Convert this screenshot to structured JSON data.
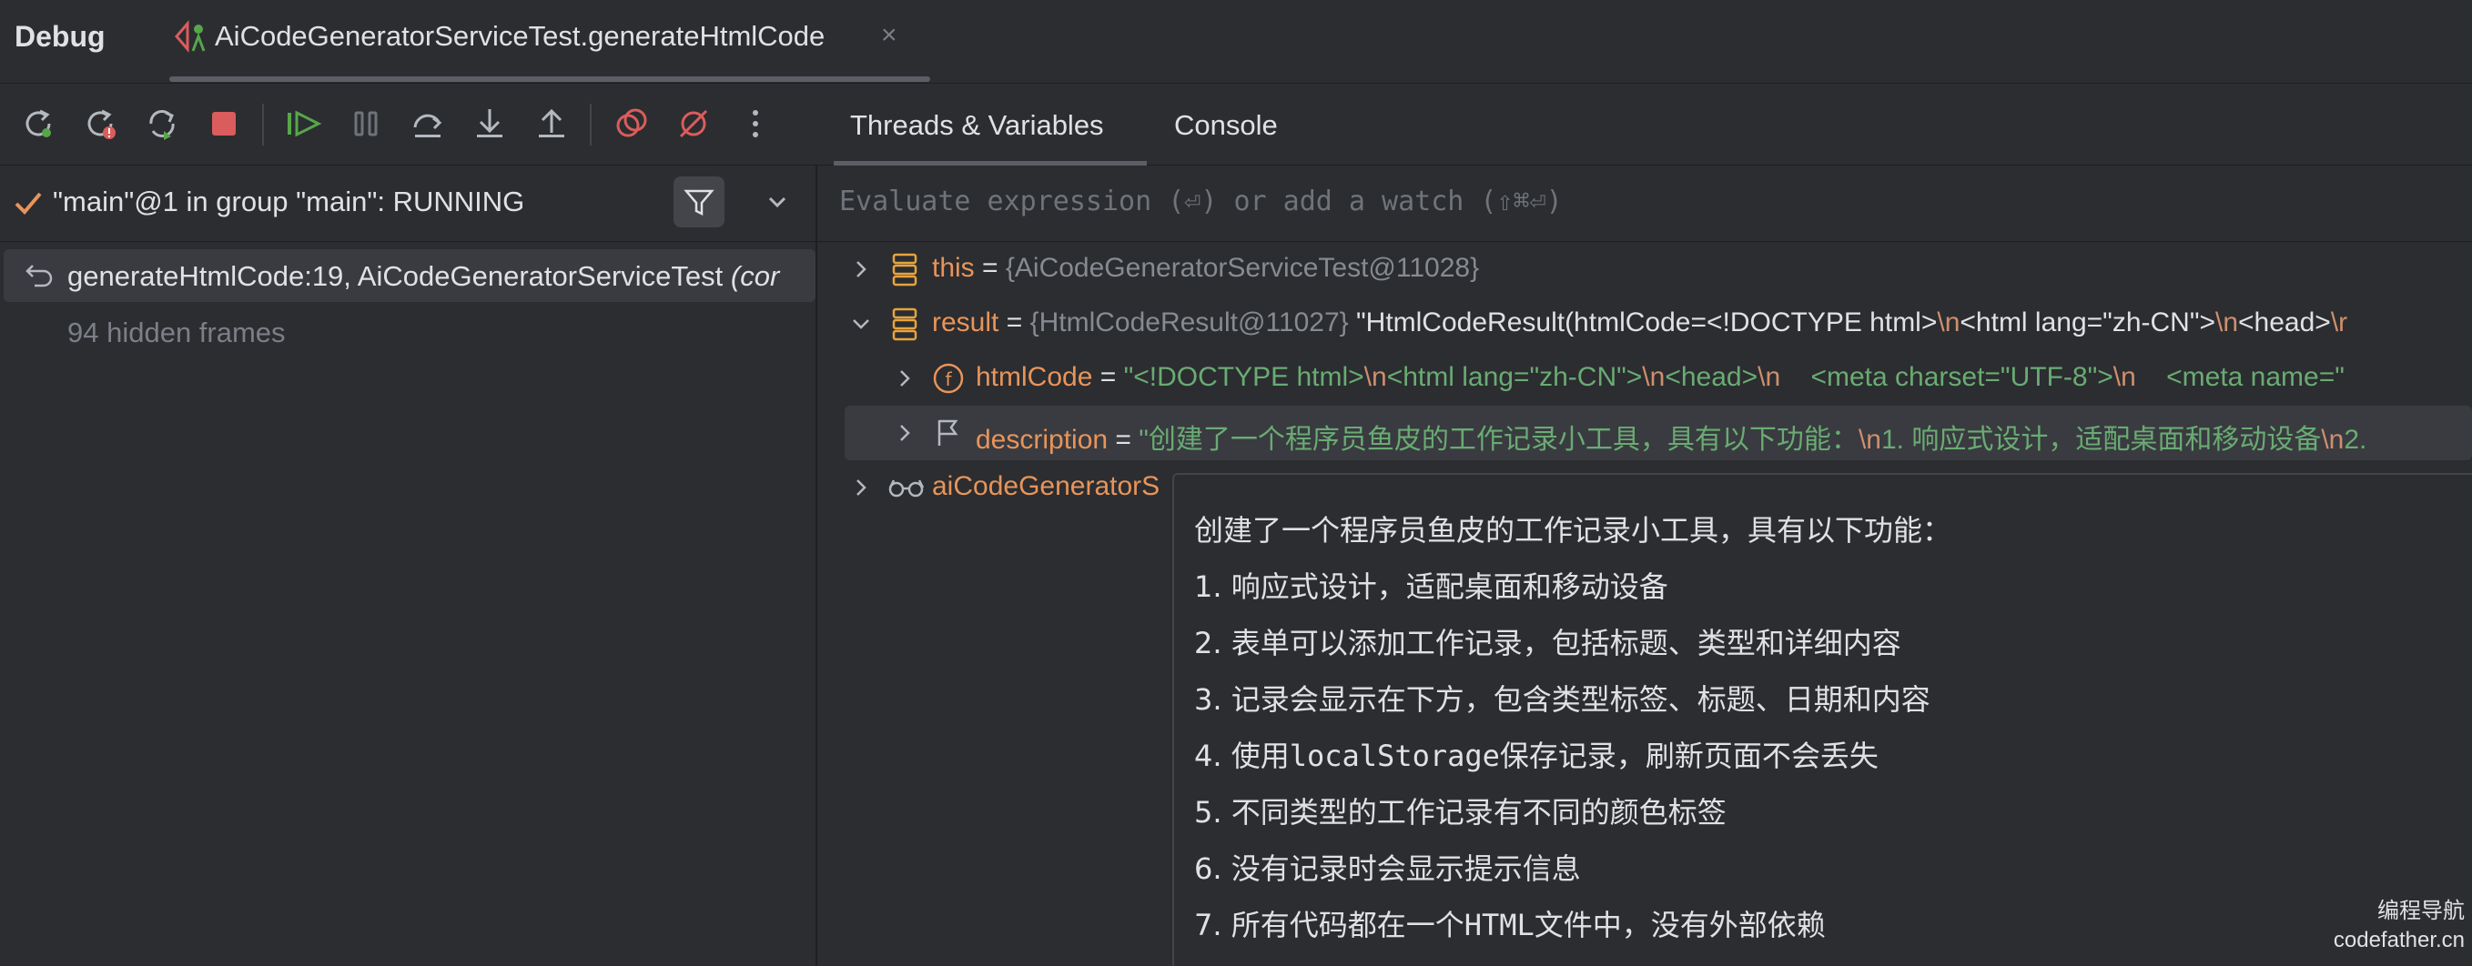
{
  "titlebar": {
    "title": "Debug",
    "tab_label": "AiCodeGeneratorServiceTest.generateHtmlCode",
    "close_glyph": "×"
  },
  "toolbar": {
    "buttons": [
      "rerun-icon",
      "rerun-failed-icon",
      "restart-icon",
      "stop-icon",
      "resume-icon",
      "pause-icon",
      "step-over-icon",
      "step-into-icon",
      "step-out-icon",
      "view-breakpoints-icon",
      "mute-breakpoints-icon",
      "more-icon"
    ],
    "panel_tabs": [
      "Threads & Variables",
      "Console"
    ]
  },
  "threads": {
    "thread_label": "\"main\"@1 in group \"main\": RUNNING",
    "frame_label": "generateHtmlCode:19, AiCodeGeneratorServiceTest",
    "frame_suffix": "(cor",
    "hidden_frames": "94 hidden frames"
  },
  "evaluate": {
    "placeholder": "Evaluate expression (⏎) or add a watch (⇧⌘⏎)"
  },
  "variables": {
    "this": {
      "name": "this",
      "eq": " = ",
      "ref": "{AiCodeGeneratorServiceTest@11028}"
    },
    "result": {
      "name": "result",
      "eq": " = ",
      "ref": "{HtmlCodeResult@11027}",
      "p1": " \"HtmlCodeResult(htmlCode=<!DOCTYPE html>",
      "e1": "\\n",
      "p2": "<html lang=\"zh-CN\">",
      "e2": "\\n",
      "p3": "<head>",
      "e3": "\\r"
    },
    "htmlCode": {
      "name": "htmlCode",
      "eq": " = ",
      "s1": "\"<!DOCTYPE html>",
      "e1": "\\n",
      "s2": "<html lang=\"zh-CN\">",
      "e2": "\\n",
      "s3": "<head>",
      "e3": "\\n",
      "s4": "    <meta charset=\"UTF-8\">",
      "e4": "\\n",
      "s5": "    <meta name=\""
    },
    "description": {
      "name": "description",
      "eq": " = ",
      "s1": "\"创建了一个程序员鱼皮的工作记录小工具，具有以下功能：",
      "e1": "\\n",
      "s2": "1. 响应式设计，适配桌面和移动设备",
      "e2": "\\n",
      "s3": "2."
    },
    "service": {
      "name": "aiCodeGeneratorS"
    }
  },
  "tooltip": {
    "lines": [
      "创建了一个程序员鱼皮的工作记录小工具，具有以下功能：",
      "1. 响应式设计，适配桌面和移动设备",
      "2. 表单可以添加工作记录，包括标题、类型和详细内容",
      "3. 记录会显示在下方，包含类型标签、标题、日期和内容",
      "5. 不同类型的工作记录有不同的颜色标签",
      "6. 没有记录时会显示提示信息"
    ],
    "line4_a": "4. 使用",
    "line4_b": "localStorage",
    "line4_c": "保存记录，刷新页面不会丢失",
    "line7_a": "7. 所有代码都在一个",
    "line7_b": "HTML",
    "line7_c": "文件中，没有外部依赖"
  },
  "watermark": {
    "line1": "编程导航",
    "line2": "codefather.cn"
  },
  "colors": {
    "background": "#2b2d30",
    "selection": "#393b40",
    "variable_name": "#e8945a",
    "string": "#6aab73",
    "escape": "#cf8e6d",
    "reference": "#868a91",
    "resume_green": "#57a64a",
    "stop_red": "#db5c5c",
    "field_badge": "#e8945a"
  }
}
